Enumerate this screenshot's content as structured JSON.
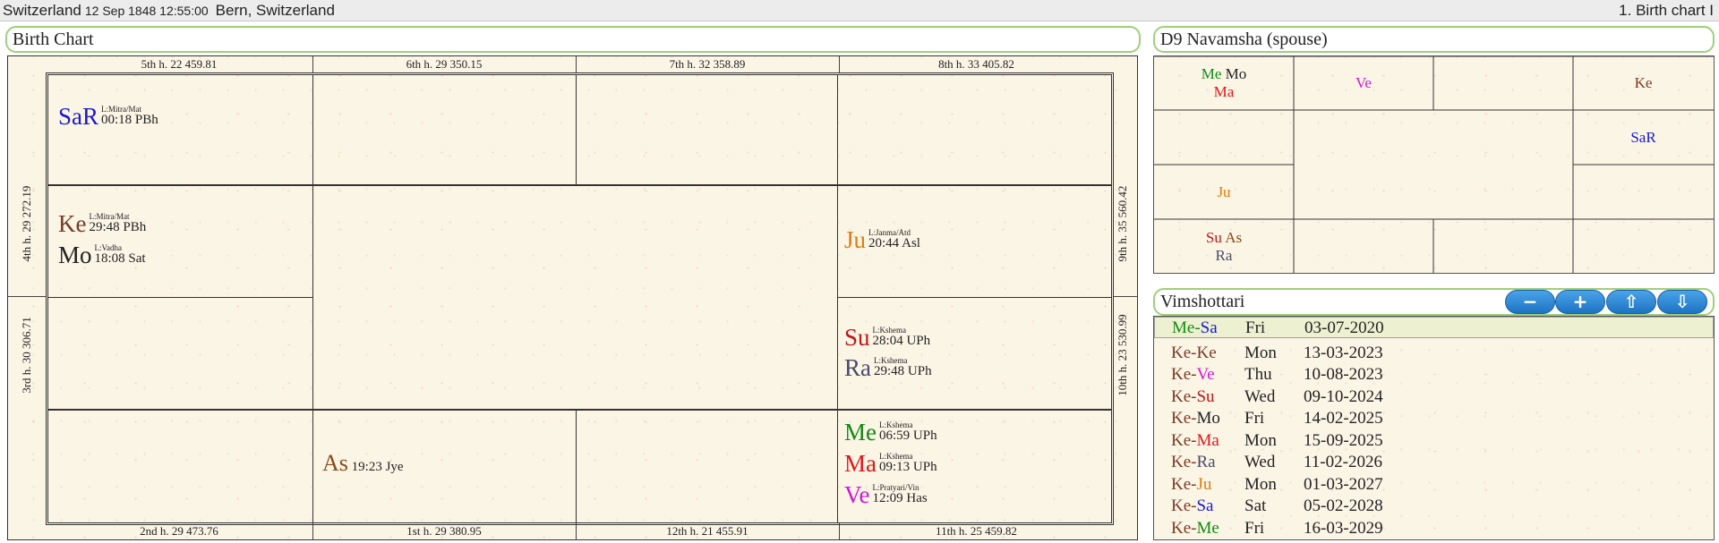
{
  "topbar": {
    "place": "Switzerland",
    "datetime": "12 Sep 1848 12:55:00",
    "city": "Bern, Switzerland",
    "right": "1. Birth chart I"
  },
  "birth_chart": {
    "title": "Birth Chart",
    "rim": {
      "h5": "5th h.  22  459.81",
      "h6": "6th h.  29  350.15",
      "h7": "7th h.  32  358.89",
      "h8": "8th h.  33  405.82",
      "h4": "4th h.  29  272.19",
      "h3": "3rd h.  30  306.71",
      "h9": "9th h.  35  560.42",
      "h10": "10th h.  23  530.99",
      "h2": "2nd h.  29  473.76",
      "h1": "1st h.  29  380.95",
      "h12": "12th h.  21  455.91",
      "h11": "11th h.  25  459.82"
    },
    "planets": {
      "sar": {
        "glyph": "SaR",
        "sub": "L:Mitra/Mat",
        "deg": "00:18 PBh",
        "color": "#1a1ad0"
      },
      "ke": {
        "glyph": "Ke",
        "sub": "L:Mitra/Mat",
        "deg": "29:48 PBh",
        "color": "#7a3a22"
      },
      "mo": {
        "glyph": "Mo",
        "sub": "L:Vadha",
        "deg": "18:08 Sat",
        "color": "#222222"
      },
      "ju": {
        "glyph": "Ju",
        "sub": "L:Janma/Atd",
        "deg": "20:44 Asl",
        "color": "#e07a10"
      },
      "su": {
        "glyph": "Su",
        "sub": "L:Kshema",
        "deg": "28:04 UPh",
        "color": "#c01515"
      },
      "ra": {
        "glyph": "Ra",
        "sub": "L:Kshema",
        "deg": "29:48 UPh",
        "color": "#4a4a6a"
      },
      "me": {
        "glyph": "Me",
        "sub": "L:Kshema",
        "deg": "06:59 UPh",
        "color": "#138a13"
      },
      "ma": {
        "glyph": "Ma",
        "sub": "L:Kshema",
        "deg": "09:13 UPh",
        "color": "#e01818"
      },
      "ve": {
        "glyph": "Ve",
        "sub": "L:Pratyari/Vin",
        "deg": "12:09 Has",
        "color": "#d018d0"
      },
      "as": {
        "glyph": "As",
        "deg": "19:23 Jye",
        "color": "#8a4a18"
      }
    }
  },
  "d9": {
    "title": "D9 Navamsha  (spouse)",
    "cells": {
      "me": "Me",
      "mo": "Mo",
      "ma": "Ma",
      "ve": "Ve",
      "ke": "Ke",
      "sar": "SaR",
      "ju": "Ju",
      "su": "Su",
      "as": "As",
      "ra": "Ra"
    }
  },
  "vimshottari": {
    "title": "Vimshottari",
    "buttons": {
      "minus": "−",
      "plus": "+",
      "up": "⇧",
      "down": "⇩"
    },
    "rows": [
      {
        "a": "Me",
        "b": "Sa",
        "day": "Fri",
        "date": "03-07-2020",
        "ca": "#138a13",
        "cb": "#1a1ad0"
      },
      {
        "a": "Ke",
        "b": "Ke",
        "day": "Mon",
        "date": "13-03-2023",
        "ca": "#7a3a22",
        "cb": "#7a3a22"
      },
      {
        "a": "Ke",
        "b": "Ve",
        "day": "Thu",
        "date": "10-08-2023",
        "ca": "#7a3a22",
        "cb": "#d018d0"
      },
      {
        "a": "Ke",
        "b": "Su",
        "day": "Wed",
        "date": "09-10-2024",
        "ca": "#7a3a22",
        "cb": "#c01515"
      },
      {
        "a": "Ke",
        "b": "Mo",
        "day": "Fri",
        "date": "14-02-2025",
        "ca": "#7a3a22",
        "cb": "#222222"
      },
      {
        "a": "Ke",
        "b": "Ma",
        "day": "Mon",
        "date": "15-09-2025",
        "ca": "#7a3a22",
        "cb": "#e01818"
      },
      {
        "a": "Ke",
        "b": "Ra",
        "day": "Wed",
        "date": "11-02-2026",
        "ca": "#7a3a22",
        "cb": "#4a4a6a"
      },
      {
        "a": "Ke",
        "b": "Ju",
        "day": "Mon",
        "date": "01-03-2027",
        "ca": "#7a3a22",
        "cb": "#e07a10"
      },
      {
        "a": "Ke",
        "b": "Sa",
        "day": "Sat",
        "date": "05-02-2028",
        "ca": "#7a3a22",
        "cb": "#1a1ad0"
      },
      {
        "a": "Ke",
        "b": "Me",
        "day": "Fri",
        "date": "16-03-2029",
        "ca": "#7a3a22",
        "cb": "#138a13"
      }
    ]
  }
}
